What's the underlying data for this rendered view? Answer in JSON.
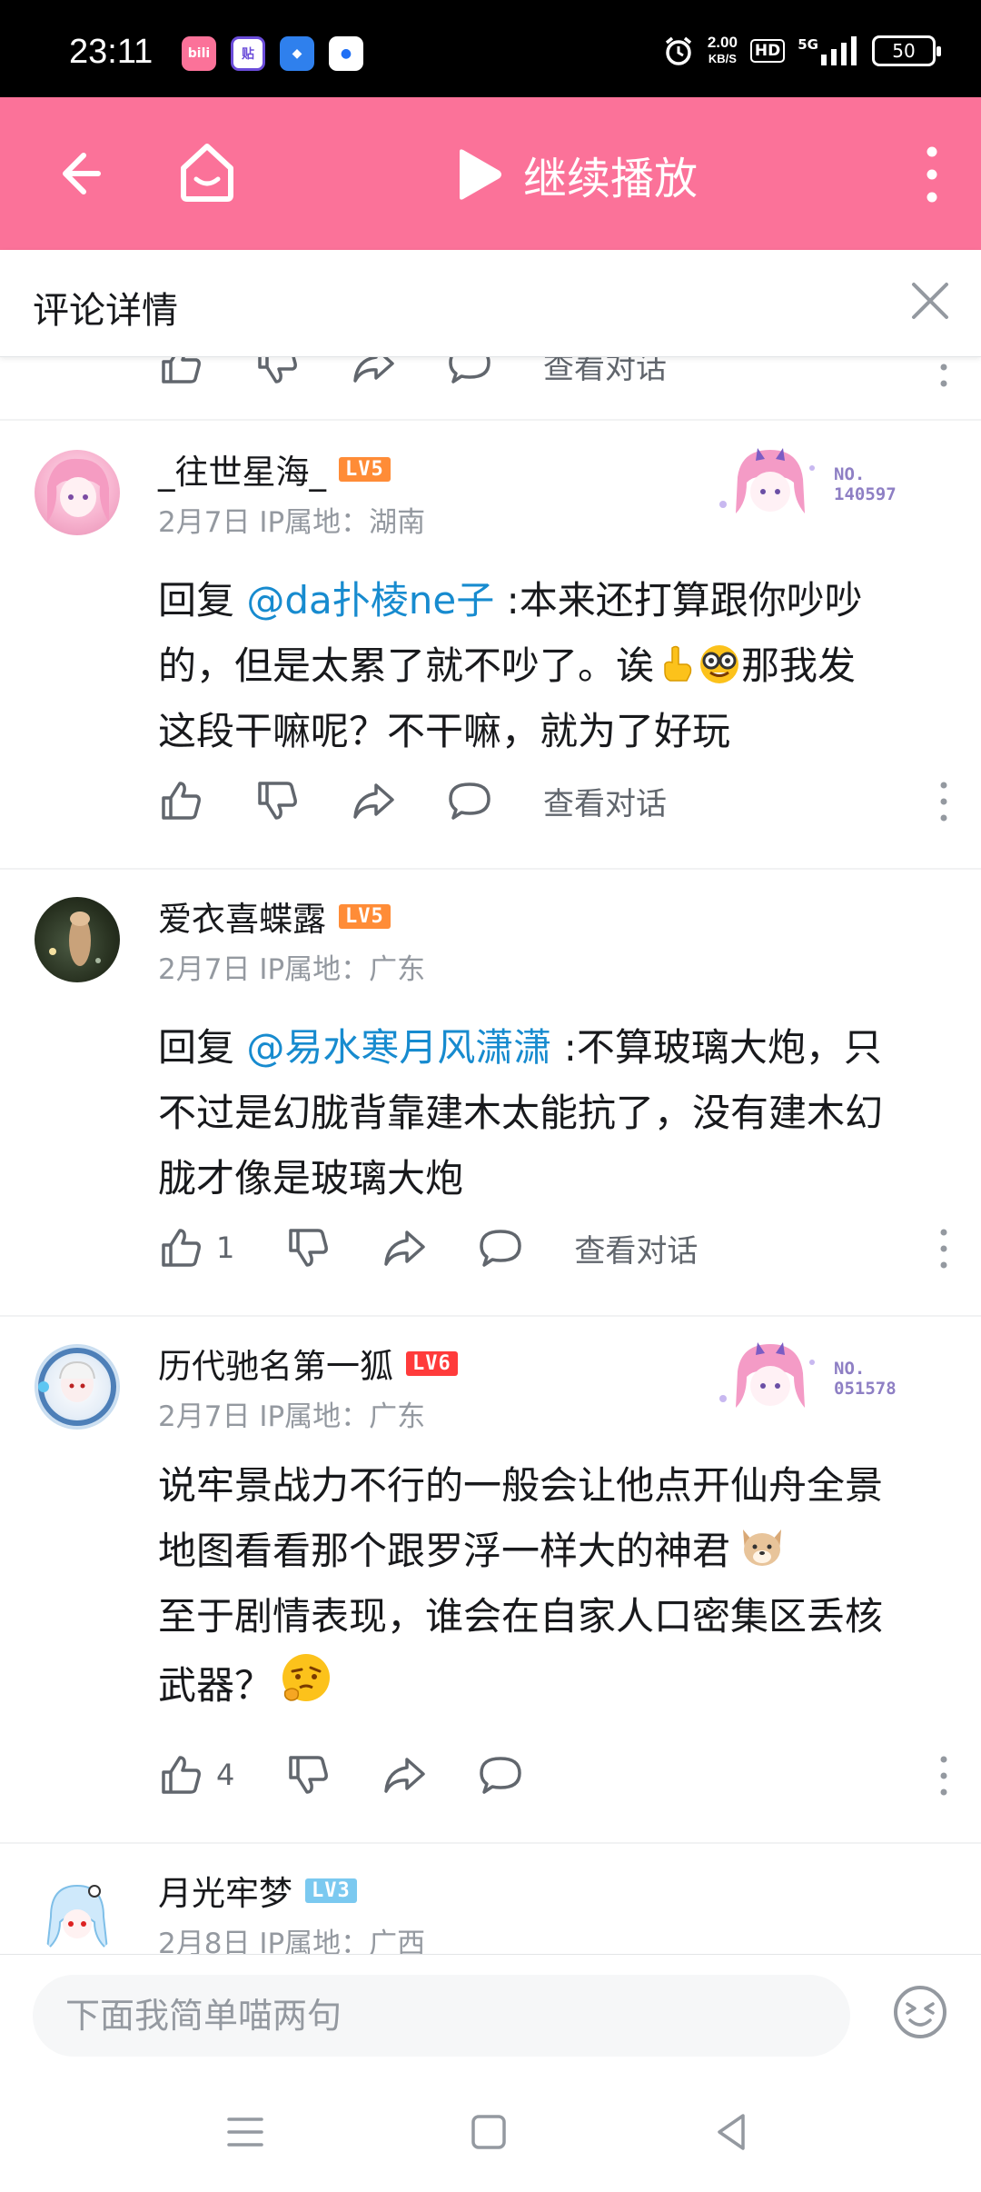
{
  "status_bar": {
    "time": "23:11",
    "net_speed_value": "2.00",
    "net_speed_unit": "KB/S",
    "hd": "HD",
    "network": "5G",
    "battery": "50",
    "notification_apps": [
      {
        "icon": "bilibili-icon",
        "color": "#fb7299",
        "glyph": "bili"
      },
      {
        "icon": "tieba-icon",
        "color": "#6a4cd9",
        "glyph": "贴"
      },
      {
        "icon": "blue-app-icon",
        "color": "#2f80ed",
        "glyph": "◆"
      },
      {
        "icon": "circle-app-icon",
        "color": "#1e6ff5",
        "glyph": "●"
      }
    ]
  },
  "top_bar": {
    "continue_label": "继续播放",
    "accent_color": "#fb7299"
  },
  "header": {
    "title": "评论详情"
  },
  "partial_row": {
    "view_conversation": "查看对话"
  },
  "comments": [
    {
      "username": "_往世星海_",
      "level": "LV5",
      "level_color": "#ff8c37",
      "date": "2月7日",
      "ip_location": "IP属地：湖南",
      "reply_prefix": "回复 ",
      "mention": "@da扑棱ne子",
      "text_line1_rest": " :本来还打算跟你吵吵",
      "text_line2": "的，但是太累了就不吵了。诶",
      "text_line2_tail": "那我发",
      "text_line3": "这段干嘛呢？不干嘛，就为了好玩",
      "badge_no": "NO.",
      "badge_number": "140597",
      "like_count": "",
      "view_conversation": "查看对话"
    },
    {
      "username": "爱衣喜蝶露",
      "level": "LV5",
      "level_color": "#ff8c37",
      "date": "2月7日",
      "ip_location": "IP属地：广东",
      "reply_prefix": "回复 ",
      "mention": "@易水寒月风潇潇",
      "text_line1_rest": " :不算玻璃大炮，只",
      "text_line2": "不过是幻胧背靠建木太能抗了，没有建木幻",
      "text_line3": "胧才像是玻璃大炮",
      "like_count": "1",
      "view_conversation": "查看对话"
    },
    {
      "username": "历代驰名第一狐",
      "level": "LV6",
      "level_color": "#ff3b3b",
      "date": "2月7日",
      "ip_location": "IP属地：广东",
      "text_line1": "说牢景战力不行的一般会让他点开仙舟全景",
      "text_line2": "地图看看那个跟罗浮一样大的神君",
      "text_line3": "至于剧情表现，谁会在自家人口密集区丢核",
      "text_line4": "武器？",
      "badge_no": "NO.",
      "badge_number": "051578",
      "like_count": "4"
    },
    {
      "username": "月光牢梦",
      "level": "LV3",
      "level_color": "#7bc9f0",
      "date": "2月8日",
      "ip_location": "IP属地：广西"
    }
  ],
  "input": {
    "placeholder": "下面我简单喵两句"
  }
}
